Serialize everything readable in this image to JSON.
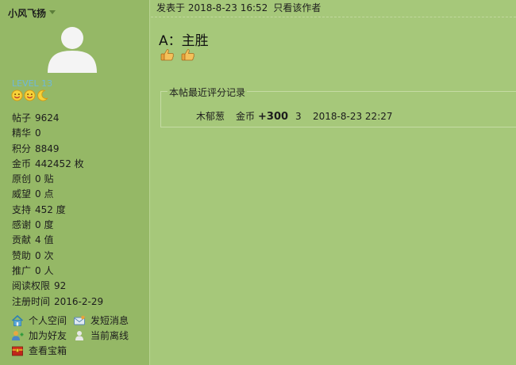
{
  "user": {
    "name": "小风飞扬",
    "level": "LEVEL 13",
    "medals": [
      "sun-medal-icon",
      "sun-medal-icon",
      "moon-medal-icon"
    ],
    "stats": [
      {
        "label": "帖子",
        "value": "9624"
      },
      {
        "label": "精华",
        "value": "0"
      },
      {
        "label": "积分",
        "value": "8849"
      },
      {
        "label": "金币",
        "value": "442452 枚"
      },
      {
        "label": "原创",
        "value": "0 贴"
      },
      {
        "label": "威望",
        "value": "0 点"
      },
      {
        "label": "支持",
        "value": "452 度"
      },
      {
        "label": "感谢",
        "value": "0 度"
      },
      {
        "label": "贡献",
        "value": "4 值"
      },
      {
        "label": "赞助",
        "value": "0 次"
      },
      {
        "label": "推广",
        "value": "0 人"
      },
      {
        "label": "阅读权限",
        "value": "92"
      },
      {
        "label": "注册时间",
        "value": "2016-2-29"
      }
    ],
    "links": {
      "space": "个人空间",
      "message": "发短消息",
      "friend": "加为好友",
      "status": "当前离线",
      "treasure": "查看宝箱"
    }
  },
  "post": {
    "header": {
      "posted_at": "发表于 2018-8-23 16:52",
      "author_only": "只看该作者"
    },
    "title": "A：主胜",
    "emoticons": [
      "thumbs-up-icon",
      "thumbs-up-icon"
    ]
  },
  "rating": {
    "legend": "本帖最近评分记录",
    "records": [
      {
        "user": "木郁葱",
        "currency": "金币",
        "amount": "+300",
        "note": "3",
        "time": "2018-8-23 22:27"
      }
    ]
  },
  "colors": {
    "page_bg": "#a6c87a",
    "sidebar_bg": "#95b866",
    "level_text": "#6fb8d9"
  }
}
